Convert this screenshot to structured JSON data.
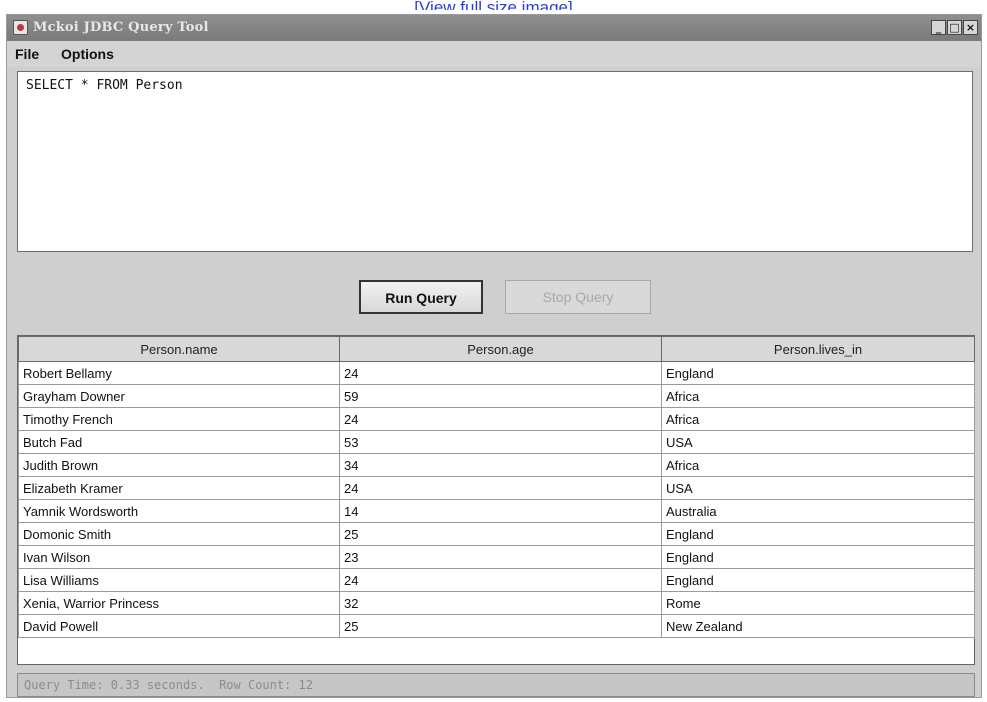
{
  "page": {
    "link_text": "[View full size image]"
  },
  "window": {
    "title": "Mckoi JDBC Query Tool",
    "controls": {
      "minimize": "_",
      "maximize": "□",
      "close": "×"
    }
  },
  "menu": {
    "file": "File",
    "options": "Options"
  },
  "query": {
    "text": "SELECT * FROM Person"
  },
  "buttons": {
    "run": "Run Query",
    "stop": "Stop Query",
    "stop_enabled": false
  },
  "results": {
    "columns": [
      "Person.name",
      "Person.age",
      "Person.lives_in"
    ],
    "rows": [
      [
        "Robert Bellamy",
        "24",
        "England"
      ],
      [
        "Grayham Downer",
        "59",
        "Africa"
      ],
      [
        "Timothy French",
        "24",
        "Africa"
      ],
      [
        "Butch Fad",
        "53",
        "USA"
      ],
      [
        "Judith Brown",
        "34",
        "Africa"
      ],
      [
        "Elizabeth Kramer",
        "24",
        "USA"
      ],
      [
        "Yamnik Wordsworth",
        "14",
        "Australia"
      ],
      [
        "Domonic Smith",
        "25",
        "England"
      ],
      [
        "Ivan Wilson",
        "23",
        "England"
      ],
      [
        "Lisa Williams",
        "24",
        "England"
      ],
      [
        "Xenia, Warrior Princess",
        "32",
        "Rome"
      ],
      [
        "David Powell",
        "25",
        "New Zealand"
      ]
    ]
  },
  "status": {
    "text": "Query Time: 0.33 seconds.  Row Count: 12"
  }
}
